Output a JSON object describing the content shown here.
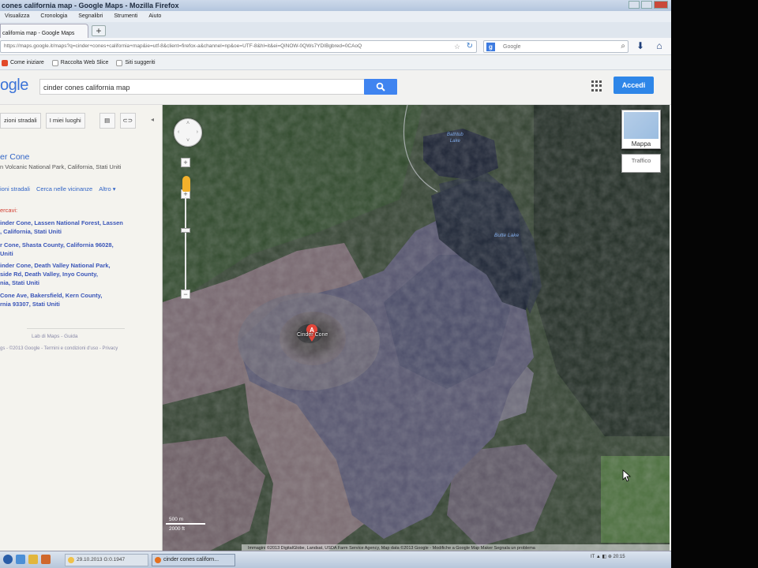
{
  "window": {
    "title": "cones california map - Google Maps - Mozilla Firefox"
  },
  "menu": [
    "Visualizza",
    "Cronologia",
    "Segnalibri",
    "Strumenti",
    "Aiuto"
  ],
  "tab": {
    "label": "california map - Google Maps",
    "new_tab_label": "+"
  },
  "navbar": {
    "url": "https://maps.google.it/maps?q=cinder+cones+california+map&ie=utf-8&client=firefox-a&channel=np&oe=UTF-8&hl=it&ei=QiNOW-0QWs7YDIBgbred=0CAoQ",
    "search_engine": "Google",
    "search_placeholder": "Google"
  },
  "bookmarks": [
    "Come iniziare",
    "Raccolta Web Slice",
    "Siti suggeriti"
  ],
  "google": {
    "logo": "ogle",
    "query": "cinder cones california map",
    "signin_label": "Accedi"
  },
  "panel": {
    "tool_directions": "zioni stradali",
    "tool_my_places": "I miei luoghi",
    "result_title": "er Cone",
    "result_subtitle": "n Volcanic National Park, California, Stati Uniti",
    "links": [
      "ioni stradali",
      "Cerca nelle vicinanze",
      "Altro ▾"
    ],
    "did_you_mean": "ercavi:",
    "suggestions": [
      "inder Cone, Lassen National Forest, Lassen\n, California, Stati Uniti",
      "r Cone, Shasta County, California 96028,\nUniti",
      "inder Cone, Death Valley National Park,\nside Rd, Death Valley, Inyo County,\nnia, Stati Uniti",
      "Cone Ave, Bakersfield, Kern County,\nrnia 93307, Stati Uniti"
    ],
    "footer_links": "Lab di Maps - Guida",
    "footer_legal": "gs - ©2013 Google - Termini e condizioni d'uso - Privacy"
  },
  "map": {
    "mappa_label": "Mappa",
    "traffico_label": "Traffico",
    "pin_letter": "A",
    "pin_label": "Cinder Cone",
    "lake_label": "Butte Lake",
    "lake2_label": "Bathtub\nLake",
    "scale_metric": "500 m",
    "scale_imperial": "2000 ft",
    "copyright": "Immagini ©2013 DigitalGlobe, Landsat, USDA Farm Service Agency, Map data ©2013 Google - Modifiche a Google Map Maker   Segnala un problema",
    "nav_labels": [
      "‹",
      "›",
      "˄",
      "˅"
    ]
  },
  "taskbar": {
    "item1": "29.10.2013 G:0.1947",
    "item2": "cinder cones californ...",
    "tray": "IT  ▲ ◧ ⊕ 20:15"
  },
  "colors": {
    "accent_blue": "#3f84f0",
    "signin_blue": "#2e86e8",
    "link_blue": "#3164c6",
    "suggest_blue": "#3a55b8",
    "warn_red": "#d23b2e"
  }
}
